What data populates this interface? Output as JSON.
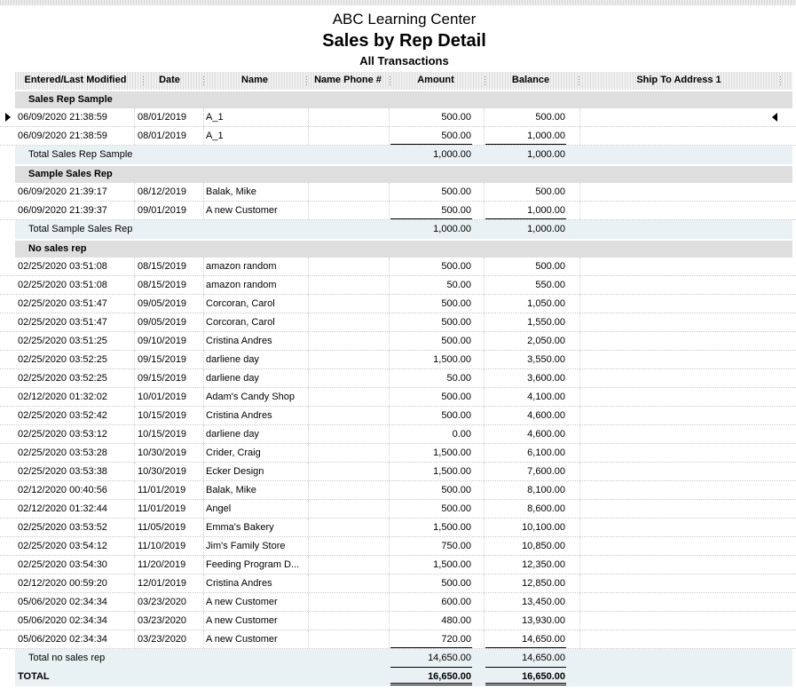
{
  "report": {
    "company": "ABC Learning Center",
    "title": "Sales by Rep Detail",
    "subtitle": "All Transactions"
  },
  "columns": {
    "entered": "Entered/Last Modified",
    "date": "Date",
    "name": "Name",
    "phone": "Name Phone #",
    "amount": "Amount",
    "balance": "Balance",
    "ship": "Ship To Address 1"
  },
  "groups": [
    {
      "label": "Sales Rep Sample",
      "rows": [
        {
          "entered": "06/09/2020 21:38:59",
          "date": "08/01/2019",
          "name": "A_1",
          "amount": "500.00",
          "balance": "500.00"
        },
        {
          "entered": "06/09/2020 21:38:59",
          "date": "08/01/2019",
          "name": "A_1",
          "amount": "500.00",
          "balance": "1,000.00"
        }
      ],
      "total": {
        "label": "Total Sales Rep Sample",
        "amount": "1,000.00",
        "balance": "1,000.00"
      }
    },
    {
      "label": "Sample Sales Rep",
      "rows": [
        {
          "entered": "06/09/2020 21:39:17",
          "date": "08/12/2019",
          "name": "Balak, Mike",
          "amount": "500.00",
          "balance": "500.00"
        },
        {
          "entered": "06/09/2020 21:39:37",
          "date": "09/01/2019",
          "name": "A new Customer",
          "amount": "500.00",
          "balance": "1,000.00"
        }
      ],
      "total": {
        "label": "Total Sample Sales Rep",
        "amount": "1,000.00",
        "balance": "1,000.00"
      }
    },
    {
      "label": "No sales rep",
      "rows": [
        {
          "entered": "02/25/2020 03:51:08",
          "date": "08/15/2019",
          "name": "amazon random",
          "amount": "500.00",
          "balance": "500.00"
        },
        {
          "entered": "02/25/2020 03:51:08",
          "date": "08/15/2019",
          "name": "amazon random",
          "amount": "50.00",
          "balance": "550.00"
        },
        {
          "entered": "02/25/2020 03:51:47",
          "date": "09/05/2019",
          "name": "Corcoran, Carol",
          "amount": "500.00",
          "balance": "1,050.00"
        },
        {
          "entered": "02/25/2020 03:51:47",
          "date": "09/05/2019",
          "name": "Corcoran, Carol",
          "amount": "500.00",
          "balance": "1,550.00"
        },
        {
          "entered": "02/25/2020 03:51:25",
          "date": "09/10/2019",
          "name": "Cristina Andres",
          "amount": "500.00",
          "balance": "2,050.00"
        },
        {
          "entered": "02/25/2020 03:52:25",
          "date": "09/15/2019",
          "name": "darliene day",
          "amount": "1,500.00",
          "balance": "3,550.00"
        },
        {
          "entered": "02/25/2020 03:52:25",
          "date": "09/15/2019",
          "name": "darliene day",
          "amount": "50.00",
          "balance": "3,600.00"
        },
        {
          "entered": "02/12/2020 01:32:02",
          "date": "10/01/2019",
          "name": "Adam's Candy Shop",
          "amount": "500.00",
          "balance": "4,100.00"
        },
        {
          "entered": "02/25/2020 03:52:42",
          "date": "10/15/2019",
          "name": "Cristina Andres",
          "amount": "500.00",
          "balance": "4,600.00"
        },
        {
          "entered": "02/25/2020 03:53:12",
          "date": "10/15/2019",
          "name": "darliene day",
          "amount": "0.00",
          "balance": "4,600.00"
        },
        {
          "entered": "02/25/2020 03:53:28",
          "date": "10/30/2019",
          "name": "Crider, Craig",
          "amount": "1,500.00",
          "balance": "6,100.00"
        },
        {
          "entered": "02/25/2020 03:53:38",
          "date": "10/30/2019",
          "name": "Ecker Design",
          "amount": "1,500.00",
          "balance": "7,600.00"
        },
        {
          "entered": "02/12/2020 00:40:56",
          "date": "11/01/2019",
          "name": "Balak, Mike",
          "amount": "500.00",
          "balance": "8,100.00"
        },
        {
          "entered": "02/12/2020 01:32:44",
          "date": "11/01/2019",
          "name": "Angel",
          "amount": "500.00",
          "balance": "8,600.00"
        },
        {
          "entered": "02/25/2020 03:53:52",
          "date": "11/05/2019",
          "name": "Emma's Bakery",
          "amount": "1,500.00",
          "balance": "10,100.00"
        },
        {
          "entered": "02/25/2020 03:54:12",
          "date": "11/10/2019",
          "name": "Jim's Family Store",
          "amount": "750.00",
          "balance": "10,850.00"
        },
        {
          "entered": "02/25/2020 03:54:30",
          "date": "11/20/2019",
          "name": "Feeding Program D...",
          "amount": "1,500.00",
          "balance": "12,350.00"
        },
        {
          "entered": "02/12/2020 00:59:20",
          "date": "12/01/2019",
          "name": "Cristina Andres",
          "amount": "500.00",
          "balance": "12,850.00"
        },
        {
          "entered": "05/06/2020 02:34:34",
          "date": "03/23/2020",
          "name": "A new Customer",
          "amount": "600.00",
          "balance": "13,450.00"
        },
        {
          "entered": "05/06/2020 02:34:34",
          "date": "03/23/2020",
          "name": "A new Customer",
          "amount": "480.00",
          "balance": "13,930.00"
        },
        {
          "entered": "05/06/2020 02:34:34",
          "date": "03/23/2020",
          "name": "A new Customer",
          "amount": "720.00",
          "balance": "14,650.00"
        }
      ],
      "total": {
        "label": "Total no sales rep",
        "amount": "14,650.00",
        "balance": "14,650.00"
      }
    }
  ],
  "grand_total": {
    "label": "TOTAL",
    "amount": "16,650.00",
    "balance": "16,650.00"
  },
  "icons": {
    "row_marker_left": "triangle-right-icon",
    "row_marker_right": "triangle-left-icon"
  }
}
